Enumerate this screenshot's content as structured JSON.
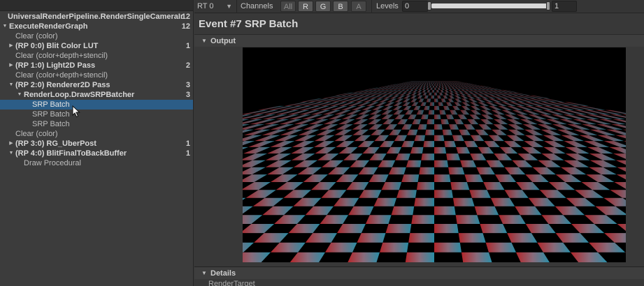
{
  "tree": [
    {
      "label": "UniversalRenderPipeline.RenderSingleCameraInte",
      "count": "12",
      "indent": 0,
      "arrow": "",
      "bold": true,
      "selected": false
    },
    {
      "label": "ExecuteRenderGraph",
      "count": "12",
      "indent": 1,
      "arrow": "down",
      "bold": true,
      "selected": false
    },
    {
      "label": "Clear (color)",
      "count": "",
      "indent": 2,
      "arrow": "",
      "bold": false,
      "selected": false
    },
    {
      "label": "(RP 0:0) Blit Color LUT",
      "count": "1",
      "indent": 2,
      "arrow": "right",
      "bold": true,
      "selected": false
    },
    {
      "label": "Clear (color+depth+stencil)",
      "count": "",
      "indent": 2,
      "arrow": "",
      "bold": false,
      "selected": false
    },
    {
      "label": "(RP 1:0) Light2D Pass",
      "count": "2",
      "indent": 2,
      "arrow": "right",
      "bold": true,
      "selected": false
    },
    {
      "label": "Clear (color+depth+stencil)",
      "count": "",
      "indent": 2,
      "arrow": "",
      "bold": false,
      "selected": false
    },
    {
      "label": "(RP 2:0) Renderer2D Pass",
      "count": "3",
      "indent": 2,
      "arrow": "down",
      "bold": true,
      "selected": false
    },
    {
      "label": "RenderLoop.DrawSRPBatcher",
      "count": "3",
      "indent": 3,
      "arrow": "down",
      "bold": true,
      "selected": false
    },
    {
      "label": "SRP Batch",
      "count": "",
      "indent": 4,
      "arrow": "",
      "bold": false,
      "selected": true
    },
    {
      "label": "SRP Batch",
      "count": "",
      "indent": 4,
      "arrow": "",
      "bold": false,
      "selected": false
    },
    {
      "label": "SRP Batch",
      "count": "",
      "indent": 4,
      "arrow": "",
      "bold": false,
      "selected": false
    },
    {
      "label": "Clear (color)",
      "count": "",
      "indent": 2,
      "arrow": "",
      "bold": false,
      "selected": false
    },
    {
      "label": "(RP 3:0) RG_UberPost",
      "count": "1",
      "indent": 2,
      "arrow": "right",
      "bold": true,
      "selected": false
    },
    {
      "label": "(RP 4:0) BlitFinalToBackBuffer",
      "count": "1",
      "indent": 2,
      "arrow": "down",
      "bold": true,
      "selected": false
    },
    {
      "label": "Draw Procedural",
      "count": "",
      "indent": 3,
      "arrow": "",
      "bold": false,
      "selected": false
    }
  ],
  "toolbar": {
    "rt_label": "RT 0",
    "channels_label": "Channels",
    "channels": [
      {
        "label": "All",
        "on": false
      },
      {
        "label": "R",
        "on": true
      },
      {
        "label": "G",
        "on": true
      },
      {
        "label": "B",
        "on": true
      },
      {
        "label": "A",
        "on": false
      }
    ],
    "levels_label": "Levels",
    "level_min": "0",
    "level_max": "1"
  },
  "event_title": "Event #7 SRP Batch",
  "output_label": "Output",
  "details_label": "Details",
  "details_sub": "RenderTarget",
  "colors": {
    "selection": "#2c5d87",
    "floor_red": "#b4262a",
    "floor_cyan": "#2a8fa8"
  }
}
